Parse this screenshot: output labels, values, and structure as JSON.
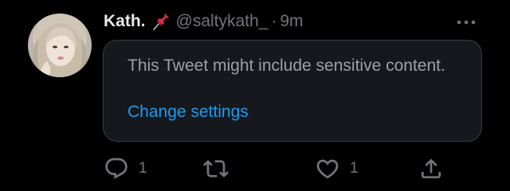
{
  "tweet": {
    "display_name": "Kath.",
    "pin_emoji_icon": "pushpin-icon",
    "handle": "@saltykath_",
    "separator": "·",
    "time": "9m",
    "more_icon": "more-horizontal-icon",
    "sensitive_notice": {
      "text": "This Tweet might include sensitive content.",
      "link_label": "Change settings"
    },
    "actions": {
      "reply_count": "1",
      "retweet_count": "",
      "like_count": "1",
      "share_icon": "share-icon"
    }
  },
  "colors": {
    "background": "#000000",
    "primary_text": "#e7e9ea",
    "secondary_text": "#71767b",
    "link": "#1d9bf0",
    "card_border": "#3a3f44",
    "pin_red": "#dd2e44"
  }
}
